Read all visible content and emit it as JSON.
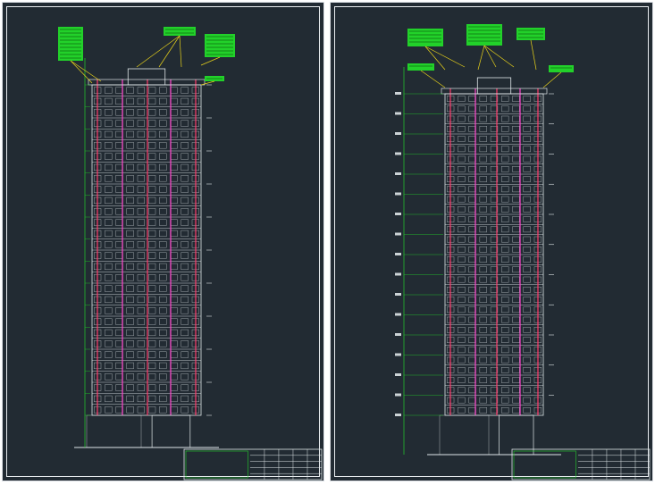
{
  "drawings": [
    {
      "name": "left-elevation-sheet",
      "title_block_present": true
    },
    {
      "name": "right-elevation-sheet",
      "title_block_present": true
    }
  ],
  "colors": {
    "background": "#222b33",
    "frame": "#e8ecef",
    "facade": "#dfe6e8",
    "annotation_green": "#22d12a",
    "leader_yellow": "#e8d21a",
    "pipe_red": "#ff3b6b",
    "magenta": "#ff44cc"
  }
}
